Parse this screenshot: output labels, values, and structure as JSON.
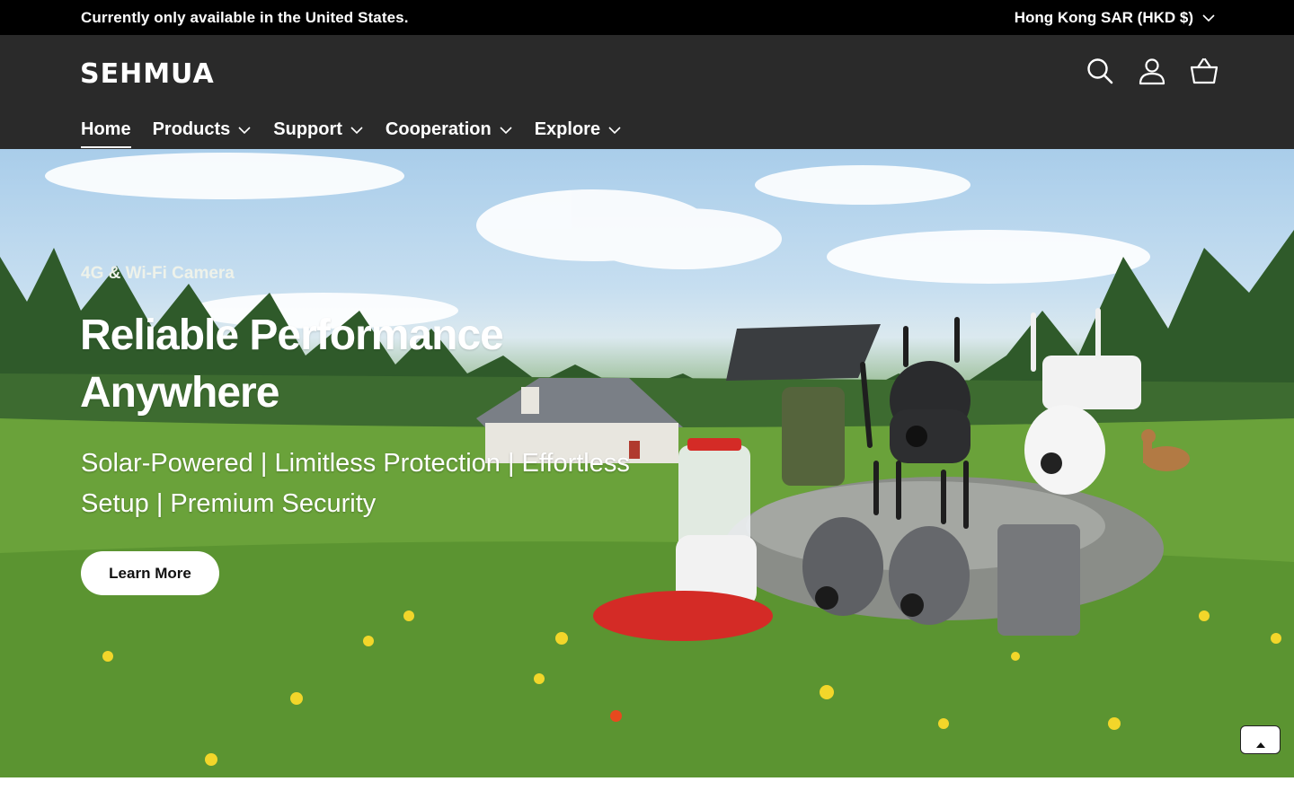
{
  "announcement": {
    "text": "Currently only available in the United States.",
    "currency": "Hong Kong SAR (HKD $)"
  },
  "header": {
    "logo": "SEHMUA",
    "icons": [
      "search-icon",
      "account-icon",
      "cart-icon"
    ]
  },
  "nav": {
    "items": [
      {
        "label": "Home",
        "active": true,
        "dropdown": false
      },
      {
        "label": "Products",
        "dropdown": true
      },
      {
        "label": "Support",
        "dropdown": true
      },
      {
        "label": "Cooperation",
        "dropdown": true
      },
      {
        "label": "Explore",
        "dropdown": true
      }
    ]
  },
  "hero": {
    "subtitle": "4G & Wi-Fi Camera",
    "title": "Reliable Performance Anywhere",
    "description": "Solar-Powered | Limitless Protection | Effortless Setup | Premium Security",
    "button": "Learn More",
    "active_slide_color": "#e8491e"
  },
  "colors": {
    "announcement_bg": "#000000",
    "header_bg": "#2a2a2a",
    "accent": "#e8491e"
  }
}
